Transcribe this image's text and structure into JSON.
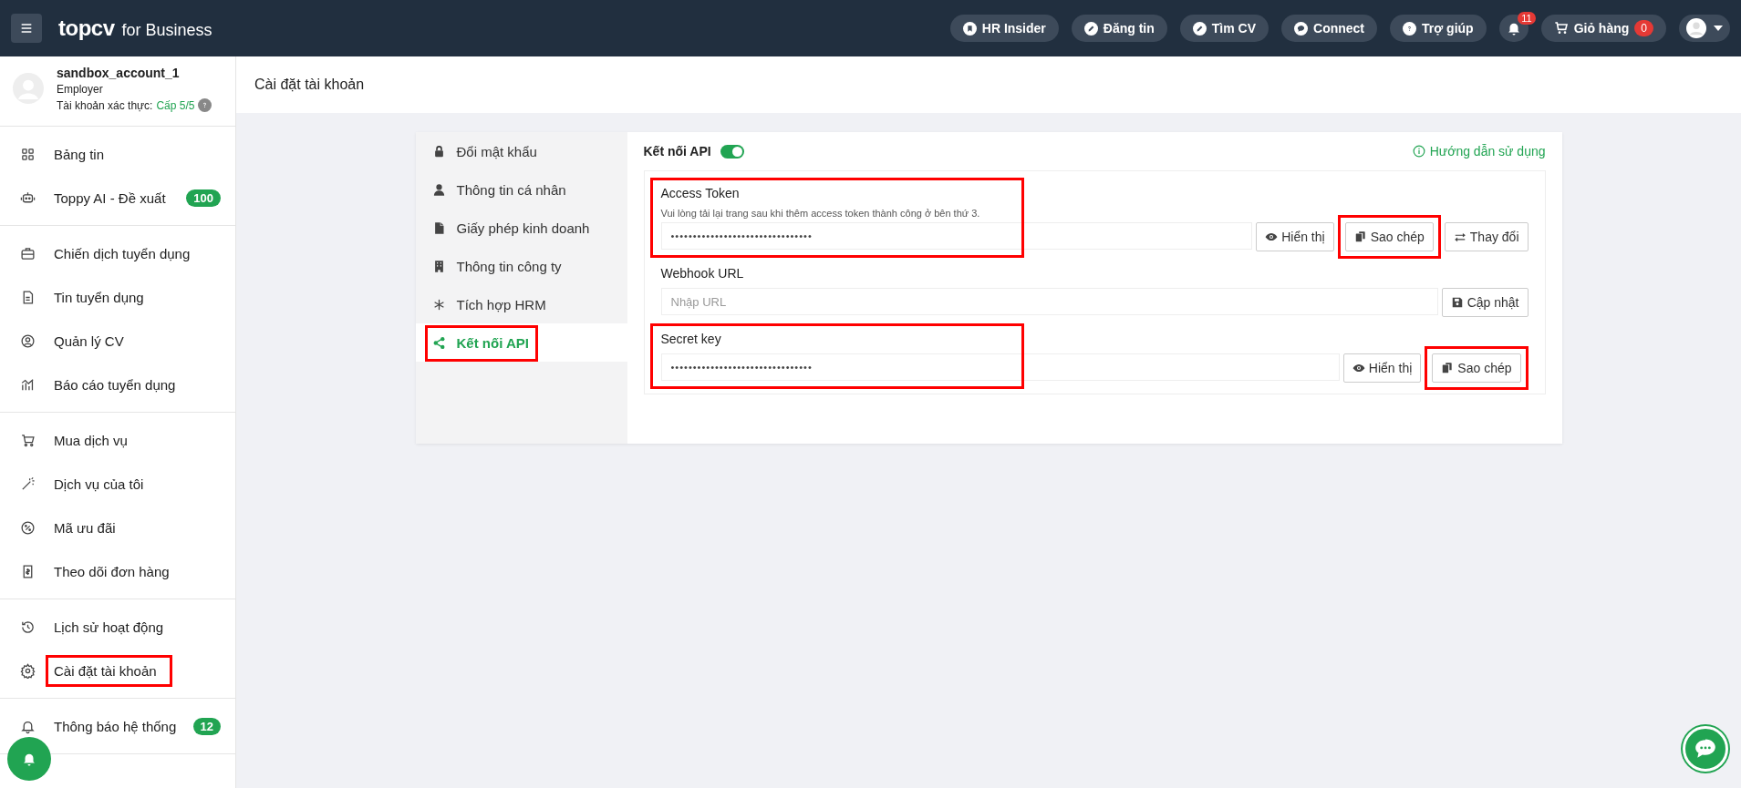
{
  "topbar": {
    "brand": "topcv",
    "brand_suffix": "for Business",
    "nav": [
      {
        "label": "HR Insider"
      },
      {
        "label": "Đăng tin"
      },
      {
        "label": "Tìm CV"
      },
      {
        "label": "Connect"
      },
      {
        "label": "Trợ giúp"
      }
    ],
    "notification_count": "11",
    "cart": {
      "label": "Giỏ hàng",
      "count": "0"
    }
  },
  "sidebar": {
    "profile": {
      "name": "sandbox_account_1",
      "role": "Employer",
      "verify_label": "Tài khoản xác thực:",
      "verify_level": "Cấp 5/5"
    },
    "groups": [
      [
        {
          "label": "Bảng tin",
          "annotated": false
        },
        {
          "label": "Toppy AI - Đề xuất",
          "badge": "100",
          "annotated": false
        }
      ],
      [
        {
          "label": "Chiến dịch tuyển dụng",
          "annotated": false
        },
        {
          "label": "Tin tuyển dụng",
          "annotated": false
        },
        {
          "label": "Quản lý CV",
          "annotated": false
        },
        {
          "label": "Báo cáo tuyển dụng",
          "annotated": false
        }
      ],
      [
        {
          "label": "Mua dịch vụ",
          "annotated": false
        },
        {
          "label": "Dịch vụ của tôi",
          "annotated": false
        },
        {
          "label": "Mã ưu đãi",
          "annotated": false
        },
        {
          "label": "Theo dõi đơn hàng",
          "annotated": false
        }
      ],
      [
        {
          "label": "Lịch sử hoạt động",
          "annotated": false
        },
        {
          "label": "Cài đặt tài khoản",
          "annotated": true
        }
      ],
      [
        {
          "label": "Thông báo hệ thống",
          "badge": "12",
          "annotated": false
        }
      ]
    ]
  },
  "page": {
    "title": "Cài đặt tài khoản"
  },
  "settings_tabs": [
    {
      "label": "Đổi mật khẩu",
      "selected": false,
      "annotated": false
    },
    {
      "label": "Thông tin cá nhân",
      "selected": false,
      "annotated": false
    },
    {
      "label": "Giấy phép kinh doanh",
      "selected": false,
      "annotated": false
    },
    {
      "label": "Thông tin công ty",
      "selected": false,
      "annotated": false
    },
    {
      "label": "Tích hợp HRM",
      "selected": false,
      "annotated": false
    },
    {
      "label": "Kết nối API",
      "selected": true,
      "annotated": true
    }
  ],
  "api_panel": {
    "toggle": {
      "label": "Kết nối API",
      "on": true
    },
    "help_link": "Hướng dẫn sử dụng",
    "fields": [
      {
        "label": "Access Token",
        "hint": "Vui lòng tải lại trang sau khi thêm access token thành công ở bên thứ 3.",
        "value": "••••••••••••••••••••••••••••••••",
        "annotated": true,
        "buttons": [
          {
            "kind": "show",
            "label": "Hiển thị",
            "annotated": false
          },
          {
            "kind": "copy",
            "label": "Sao chép",
            "annotated": true
          },
          {
            "kind": "change",
            "label": "Thay đổi",
            "annotated": false
          }
        ]
      },
      {
        "label": "Webhook URL",
        "placeholder": "Nhập URL",
        "annotated": false,
        "buttons": [
          {
            "kind": "save",
            "label": "Cập nhật",
            "annotated": false
          }
        ]
      },
      {
        "label": "Secret key",
        "value": "••••••••••••••••••••••••••••••••",
        "annotated": true,
        "buttons": [
          {
            "kind": "show",
            "label": "Hiển thị",
            "annotated": false
          },
          {
            "kind": "copy",
            "label": "Sao chép",
            "annotated": true
          }
        ]
      }
    ]
  }
}
